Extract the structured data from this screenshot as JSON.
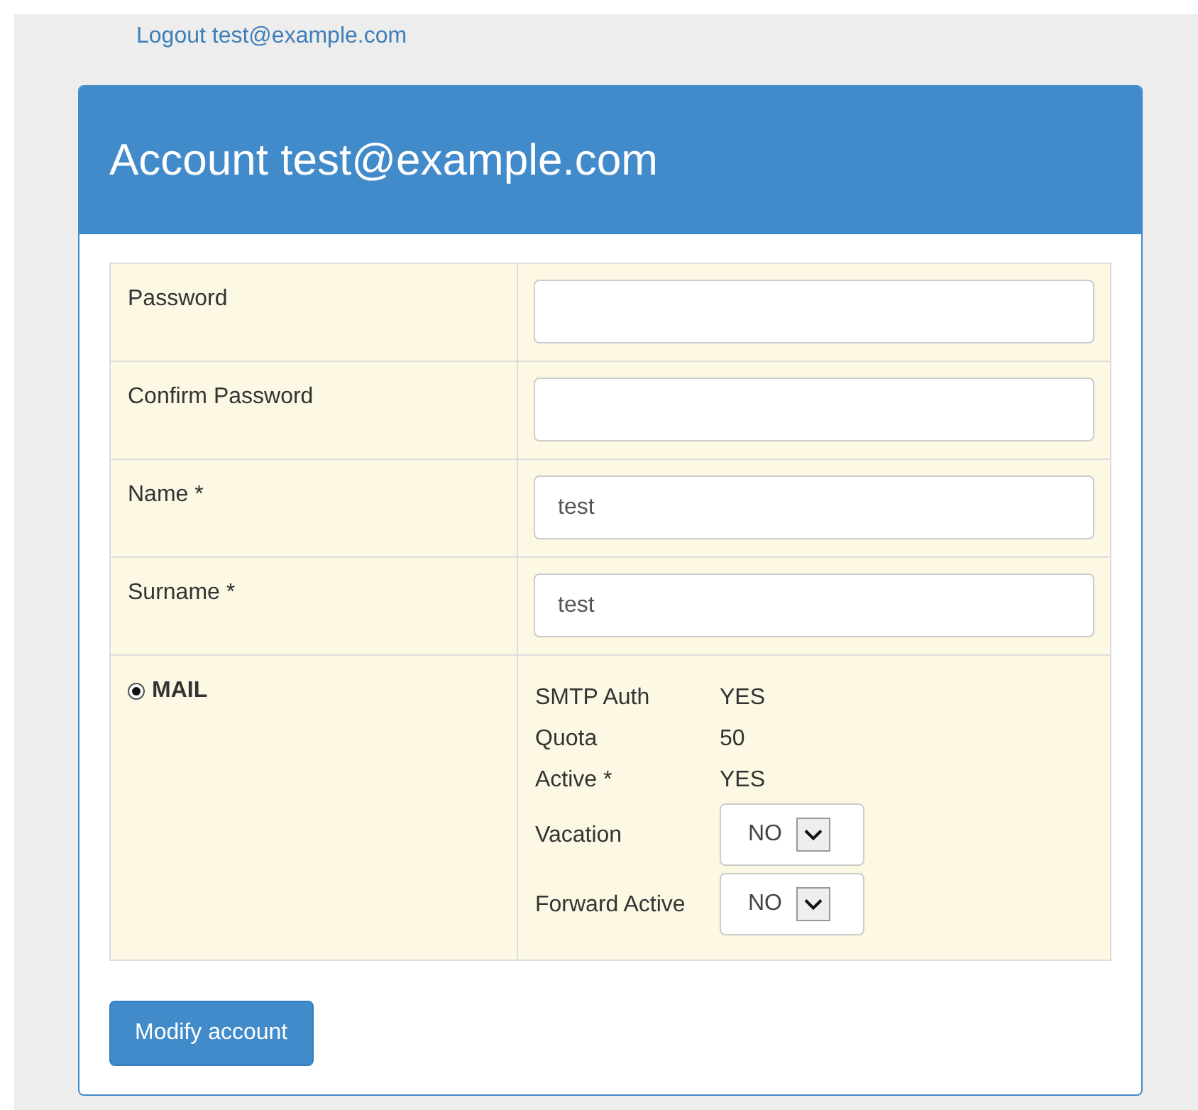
{
  "logout_link": "Logout test@example.com",
  "panel": {
    "title": "Account test@example.com"
  },
  "fields": [
    {
      "label": "Password"
    },
    {
      "label": "Confirm Password"
    },
    {
      "label": "Name *",
      "value": "test"
    },
    {
      "label": "Surname *",
      "value": "test"
    }
  ],
  "mail": {
    "label": "MAIL",
    "selected": true,
    "info": [
      {
        "label": "SMTP Auth",
        "value": "YES"
      },
      {
        "label": "Quota",
        "value": "50"
      },
      {
        "label": "Active *",
        "value": "YES"
      }
    ],
    "options": [
      {
        "label": "Vacation",
        "value": "NO"
      },
      {
        "label": "Forward Active",
        "value": "NO"
      }
    ]
  },
  "submit_button": "Modify account"
}
